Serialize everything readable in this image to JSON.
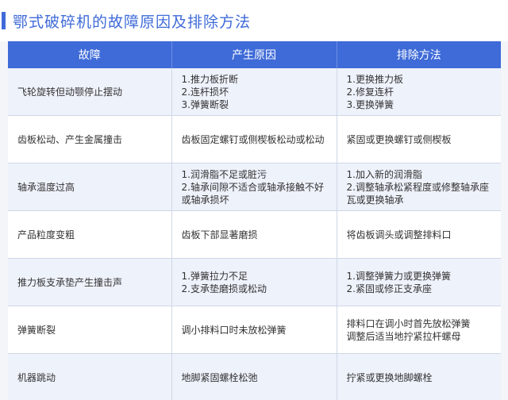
{
  "title": "鄂式破碎机的故障原因及排除方法",
  "table": {
    "headers": [
      "故障",
      "产生原因",
      "排除方法"
    ],
    "rows": [
      {
        "fault": "飞轮旋转但动颚停止摆动",
        "cause": [
          "1.推力板折断",
          "2.连杆损坏",
          "3.弹簧断裂"
        ],
        "solution": [
          "1.更换推力板",
          "2.修复连杆",
          "3.更换弹簧"
        ]
      },
      {
        "fault": "齿板松动、产生金属撞击",
        "cause": [
          "齿板固定螺钉或侧楔板松动或松动"
        ],
        "solution": [
          "紧固或更换螺钉或侧楔板"
        ]
      },
      {
        "fault": "轴承温度过高",
        "cause": [
          "1.润滑脂不足或脏污",
          "2.轴承间隙不适合或轴承接触不好",
          "或轴承损坏"
        ],
        "solution": [
          "1.加入新的润滑脂",
          "2.调整轴承松紧程度或修整轴承座",
          "瓦或更换轴承"
        ]
      },
      {
        "fault": "产品粒度变粗",
        "cause": [
          "齿板下部显著磨损"
        ],
        "solution": [
          "将齿板调头或调整排料口"
        ]
      },
      {
        "fault": "推力板支承垫产生撞击声",
        "cause": [
          "1.弹簧拉力不足",
          "2.支承垫磨损或松动"
        ],
        "solution": [
          "1.调整弹簧力或更换弹簧",
          "2.紧固或修正支承座"
        ]
      },
      {
        "fault": "弹簧断裂",
        "cause": [
          "调小排料口时未放松弹簧"
        ],
        "solution": [
          "排料口在调小时首先放松弹簧",
          "调整后适当地拧紧拉杆螺母"
        ]
      },
      {
        "fault": "机器跳动",
        "cause": [
          "地脚紧固螺栓松弛"
        ],
        "solution": [
          "拧紧或更换地脚螺栓"
        ]
      }
    ]
  }
}
